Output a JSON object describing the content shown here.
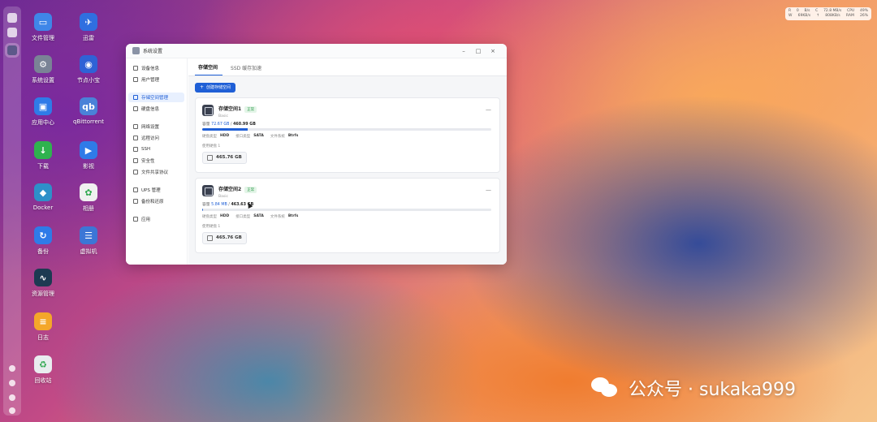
{
  "desktop": {
    "icons": [
      {
        "label": "文件管理",
        "color": "#3f86e8",
        "glyph": "▭"
      },
      {
        "label": "迅雷",
        "color": "#2f6fe0",
        "glyph": "✈"
      },
      {
        "label": "系统设置",
        "color": "#7a8396",
        "glyph": "⚙"
      },
      {
        "label": "节点小宝",
        "color": "#2f62d6",
        "glyph": "◉"
      },
      {
        "label": "应用中心",
        "color": "#2f7be8",
        "glyph": "▣"
      },
      {
        "label": "qBittorrent",
        "color": "#4a82d8",
        "glyph": "qb"
      },
      {
        "label": "下载",
        "color": "#2fb24f",
        "glyph": "↓"
      },
      {
        "label": "影视",
        "color": "#2f7be8",
        "glyph": "▶"
      },
      {
        "label": "Docker",
        "color": "#2e90c9",
        "glyph": "◆"
      },
      {
        "label": "相册",
        "color": "#f0f0f0",
        "glyph": "✿"
      },
      {
        "label": "备份",
        "color": "#2f7be8",
        "glyph": "↻"
      },
      {
        "label": "虚拟机",
        "color": "#3c76d6",
        "glyph": "☰"
      },
      {
        "label": "资源管理",
        "color": "#1d3a52",
        "glyph": "∿"
      },
      {
        "label": "日志",
        "color": "#f4a72a",
        "glyph": "≡"
      },
      {
        "label": "回收站",
        "color": "#e9ecef",
        "glyph": "♻"
      }
    ]
  },
  "monitor": {
    "row1": [
      "R",
      "0",
      "B/s",
      "C",
      "72.8 MB/s",
      "CPU",
      "49%"
    ],
    "row2": [
      "W",
      "69KB/s",
      "↑",
      "808KB/s",
      "RAM",
      "26%"
    ]
  },
  "window": {
    "title": "系统设置",
    "controls": {
      "minimize": "–",
      "maximize": "□",
      "close": "×"
    }
  },
  "sidebar": {
    "groups": [
      [
        "设备信息",
        "用户管理"
      ],
      [
        "存储空间管理",
        "硬盘信息"
      ],
      [
        "网络设置",
        "远程访问",
        "SSH",
        "安全性",
        "文件共享协议"
      ],
      [
        "UPS 管理",
        "备份和还原"
      ],
      [
        "应用"
      ]
    ],
    "active": "存储空间管理"
  },
  "tabs": [
    "存储空间",
    "SSD 缓存加速"
  ],
  "active_tab": "存储空间",
  "create_button": "创建存储空间",
  "storage_pools": [
    {
      "name": "存储空间1",
      "status": "正常",
      "type": "Basic",
      "capacity_label": "容量",
      "used": "72.67 GB",
      "total": "460.99 GB",
      "usage_fraction": 0.158,
      "disk_type_label": "硬盘类型",
      "disk_type": "HDD",
      "interface_label": "接口类型",
      "interface": "SATA",
      "fs_label": "文件系统",
      "fs": "Btrfs",
      "disks_label": "使用硬盘 1",
      "disk_size": "465.76 GB"
    },
    {
      "name": "存储空间2",
      "status": "正常",
      "type": "Basic",
      "capacity_label": "容量",
      "used": "5.84 MB",
      "total": "463.63 GB",
      "usage_fraction": 0.001,
      "disk_type_label": "硬盘类型",
      "disk_type": "HDD",
      "interface_label": "接口类型",
      "interface": "SATA",
      "fs_label": "文件系统",
      "fs": "Btrfs",
      "disks_label": "使用硬盘 1",
      "disk_size": "465.76 GB"
    }
  ],
  "watermark": "公众号 · sukaka999"
}
